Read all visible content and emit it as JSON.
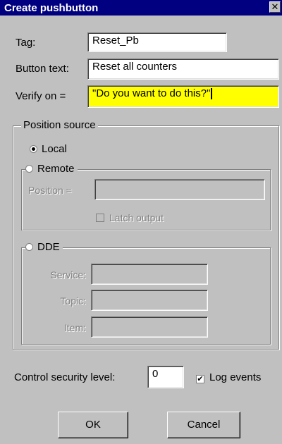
{
  "window": {
    "title": "Create pushbutton"
  },
  "form": {
    "tag_label": "Tag:",
    "tag_value": "Reset_Pb",
    "button_text_label": "Button text:",
    "button_text_value": "Reset all counters",
    "verify_label": "Verify on =",
    "verify_value": "\"Do you want to do this?\""
  },
  "position_source": {
    "legend": "Position source",
    "local_label": "Local",
    "local_selected": true,
    "remote": {
      "label": "Remote",
      "position_label": "Position =",
      "position_value": "",
      "latch_label": "Latch output",
      "latch_checked": false
    },
    "dde": {
      "label": "DDE",
      "service_label": "Service:",
      "service_value": "",
      "topic_label": "Topic:",
      "topic_value": "",
      "item_label": "Item:",
      "item_value": ""
    }
  },
  "security": {
    "label": "Control security level:",
    "value": "0",
    "log_events_label": "Log events",
    "log_events_checked": true
  },
  "buttons": {
    "ok": "OK",
    "cancel": "Cancel"
  },
  "icons": {
    "close": "close-icon",
    "check": "check-icon"
  }
}
